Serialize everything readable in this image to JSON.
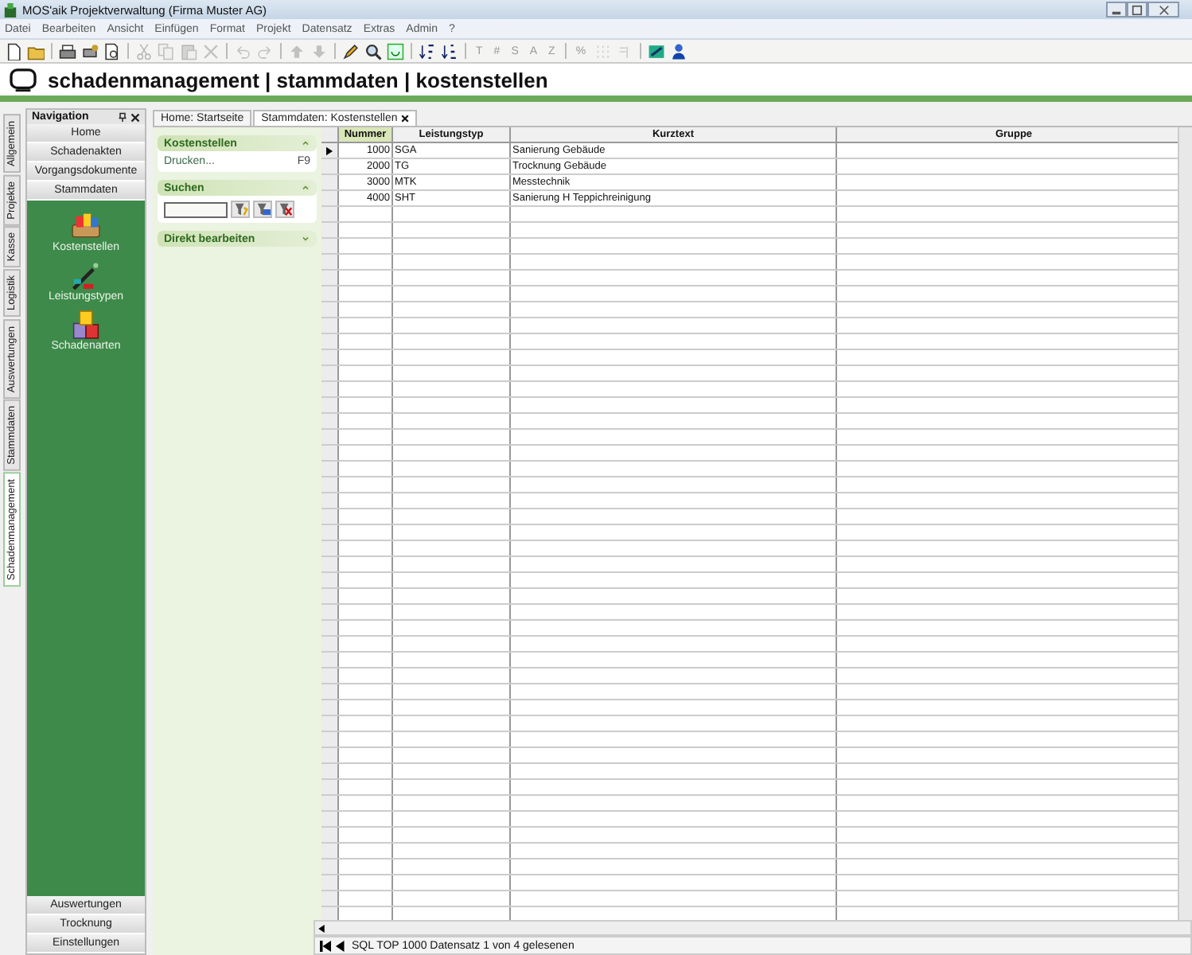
{
  "window": {
    "title": "MOS'aik Projektverwaltung (Firma Muster AG)"
  },
  "menu": [
    "Datei",
    "Bearbeiten",
    "Ansicht",
    "Einfügen",
    "Format",
    "Projekt",
    "Datensatz",
    "Extras",
    "Admin",
    "?"
  ],
  "toolbar": [
    {
      "kind": "icon",
      "disabled": false
    },
    {
      "kind": "icon",
      "disabled": false
    },
    {
      "kind": "separator"
    },
    {
      "kind": "icon",
      "disabled": false
    },
    {
      "kind": "icon",
      "disabled": false
    },
    {
      "kind": "icon",
      "disabled": false
    },
    {
      "kind": "separator"
    },
    {
      "kind": "icon",
      "disabled": true
    },
    {
      "kind": "icon",
      "disabled": true
    },
    {
      "kind": "icon",
      "disabled": true
    },
    {
      "kind": "icon",
      "disabled": true
    },
    {
      "kind": "separator"
    },
    {
      "kind": "icon",
      "disabled": true
    },
    {
      "kind": "icon",
      "disabled": true
    },
    {
      "kind": "separator"
    },
    {
      "kind": "icon",
      "disabled": true
    },
    {
      "kind": "icon",
      "disabled": true
    },
    {
      "kind": "separator"
    },
    {
      "kind": "icon",
      "disabled": false
    },
    {
      "kind": "icon",
      "disabled": false
    },
    {
      "kind": "icon",
      "disabled": false
    },
    {
      "kind": "separator"
    },
    {
      "kind": "icon",
      "disabled": false
    },
    {
      "kind": "icon",
      "disabled": false
    },
    {
      "kind": "separator"
    },
    {
      "kind": "glyph",
      "label": "T",
      "disabled": true
    },
    {
      "kind": "glyph",
      "label": "#",
      "disabled": true
    },
    {
      "kind": "glyph",
      "label": "S",
      "disabled": true
    },
    {
      "kind": "glyph",
      "label": "A",
      "disabled": true
    },
    {
      "kind": "glyph",
      "label": "Z",
      "disabled": true
    },
    {
      "kind": "separator"
    },
    {
      "kind": "glyph",
      "label": "%",
      "disabled": true
    },
    {
      "kind": "icon",
      "disabled": true
    },
    {
      "kind": "icon",
      "disabled": true
    },
    {
      "kind": "separator"
    },
    {
      "kind": "icon",
      "disabled": false
    },
    {
      "kind": "icon",
      "disabled": false
    }
  ],
  "breadcrumb": "schadenmanagement | stammdaten | kostenstellen",
  "side_tabs": [
    {
      "label": "Allgemein",
      "selected": false
    },
    {
      "label": "Projekte",
      "selected": false
    },
    {
      "label": "Kasse",
      "selected": false
    },
    {
      "label": "Logistik",
      "selected": false
    },
    {
      "label": "Auswertungen",
      "selected": false
    },
    {
      "label": "Stammdaten",
      "selected": false
    },
    {
      "label": "Schadenmanagement",
      "selected": true
    }
  ],
  "navigation": {
    "title": "Navigation",
    "top_buttons": [
      "Home",
      "Schadenakten",
      "Vorgangsdokumente",
      "Stammdaten"
    ],
    "items": [
      "Kostenstellen",
      "Leistungstypen",
      "Schadenarten"
    ],
    "bottom_buttons": [
      "Auswertungen",
      "Trocknung",
      "Einstellungen"
    ]
  },
  "doc_tabs": [
    {
      "label": "Home: Startseite",
      "selected": false
    },
    {
      "label": "Stammdaten: Kostenstellen",
      "selected": true
    }
  ],
  "task_pane": [
    {
      "kind": "links",
      "title": "Kostenstellen",
      "expanded": true,
      "item": "Drucken...",
      "shortcut": "F9"
    },
    {
      "kind": "search",
      "title": "Suchen",
      "expanded": true
    },
    {
      "title": "Direkt bearbeiten",
      "expanded": false
    }
  ],
  "table": {
    "columns": [
      "Nummer",
      "Leistungstyp",
      "Kurztext",
      "Gruppe"
    ],
    "rows": [
      {
        "cells": [
          "1000",
          "SGA",
          "Sanierung Gebäude",
          ""
        ],
        "selected": true
      },
      {
        "cells": [
          "2000",
          "TG",
          "Trocknung Gebäude",
          ""
        ],
        "selected": false
      },
      {
        "cells": [
          "3000",
          "MTK",
          "Messtechnik",
          ""
        ],
        "selected": false
      },
      {
        "cells": [
          "4000",
          "SHT",
          "Sanierung H Teppichreinigung",
          ""
        ],
        "selected": false
      }
    ]
  },
  "status_bar": "SQL TOP 1000 Datensatz 1 von 4 gelesenen"
}
